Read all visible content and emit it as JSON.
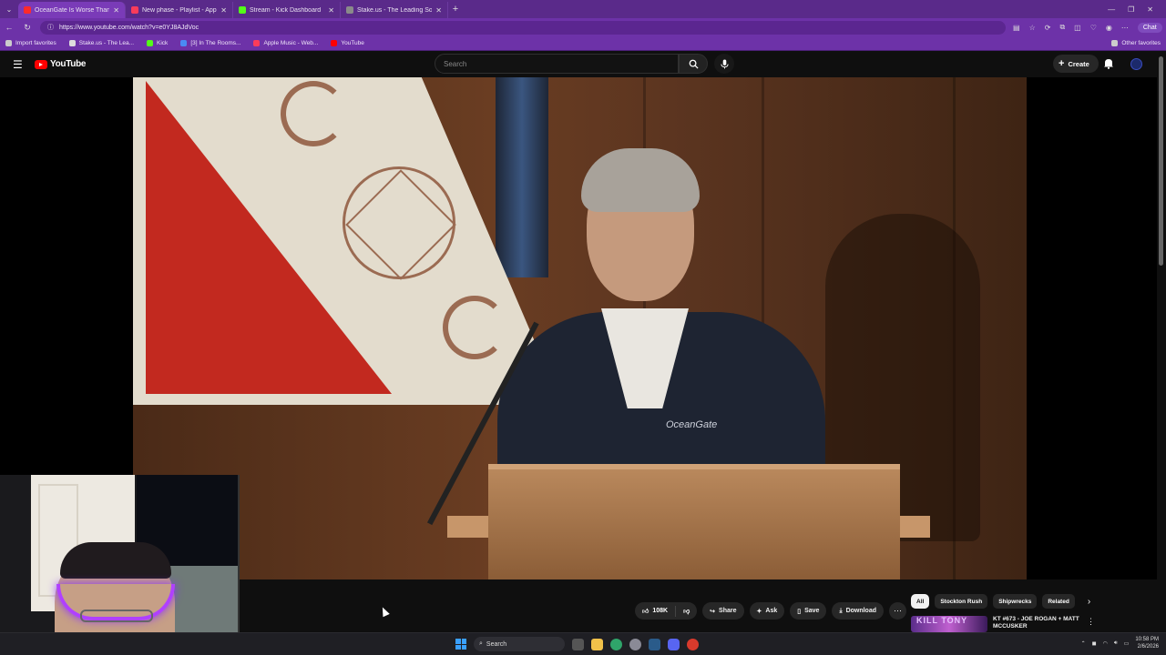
{
  "browser": {
    "tabs": [
      {
        "title": "OceanGate Is Worse Than Yo",
        "color": "#ff2a2a",
        "active": true
      },
      {
        "title": "New phase - Playlist - Apple Music",
        "color": "#fa3c5a",
        "active": false
      },
      {
        "title": "Stream - Kick Dashboard",
        "color": "#53fc18",
        "active": false
      },
      {
        "title": "Stake.us - The Leading Social Casi",
        "color": "#8a8a8a",
        "active": false
      }
    ],
    "url": "https://www.youtube.com/watch?v=e0YJ8AJdVoc",
    "chat_label": "Chat",
    "bookmarks": [
      {
        "label": "Import favorites",
        "color": "#cccccc"
      },
      {
        "label": "Stake.us - The Lea...",
        "color": "#dddddd"
      },
      {
        "label": "Kick",
        "color": "#53fc18"
      },
      {
        "label": "[3] In The Rooms...",
        "color": "#4a8af4"
      },
      {
        "label": "Apple Music - Web...",
        "color": "#fa3c5a"
      },
      {
        "label": "YouTube",
        "color": "#ff0000"
      }
    ],
    "other_favorites": "Other favorites"
  },
  "youtube": {
    "logo_text": "YouTube",
    "search_placeholder": "Search",
    "create_label": "Create",
    "likes": "108K",
    "share_label": "Share",
    "ask_label": "Ask",
    "save_label": "Save",
    "download_label": "Download",
    "chips": [
      "All",
      "Stockton Rush",
      "Shipwrecks",
      "Related"
    ],
    "recommendation": {
      "title": "KT #673 - JOE ROGAN + MATT MCCUSKER",
      "thumb_text": "KILL TONY"
    },
    "video_shirt_logo": "OceanGate"
  },
  "taskbar": {
    "search_label": "Search",
    "time": "10:58 PM",
    "date": "2/6/2026"
  }
}
